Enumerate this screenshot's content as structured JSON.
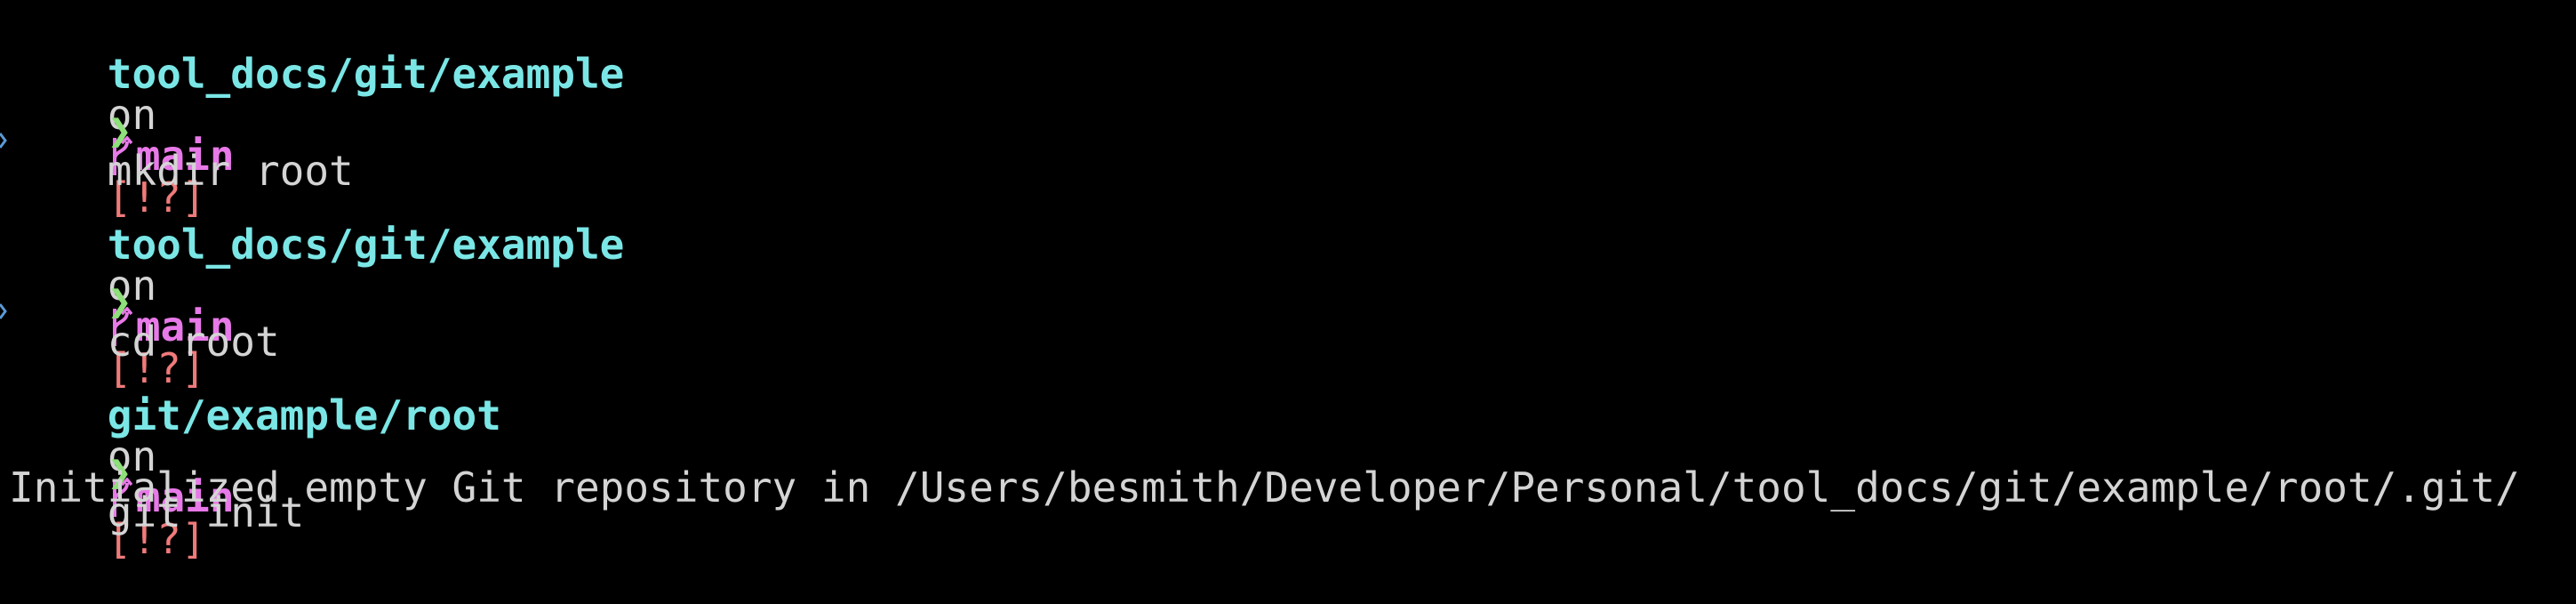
{
  "colors": {
    "background": "#000000",
    "path": "#7be6e6",
    "branch": "#e879e8",
    "status": "#f07a7a",
    "prompt": "#8ee07a",
    "text": "#d4d4d4",
    "continuation": "#5a9ad6"
  },
  "blocks": [
    {
      "header": {
        "path": "tool_docs/git/example",
        "on": "on",
        "branch_icon": "git-branch-icon",
        "branch": "main",
        "status": "[!?]"
      },
      "prompt": "❯",
      "command": "mkdir root"
    },
    {
      "header": {
        "path": "tool_docs/git/example",
        "on": "on",
        "branch_icon": "git-branch-icon",
        "branch": "main",
        "status": "[!?]"
      },
      "prompt": "❯",
      "command": "cd root"
    },
    {
      "header": {
        "path": "git/example/root",
        "on": "on",
        "branch_icon": "git-branch-icon",
        "branch": "main",
        "status": "[!?]"
      },
      "prompt": "❯",
      "command": "git init",
      "output": "Initialized empty Git repository in /Users/besmith/Developer/Personal/tool_docs/git/example/root/.git/"
    }
  ]
}
